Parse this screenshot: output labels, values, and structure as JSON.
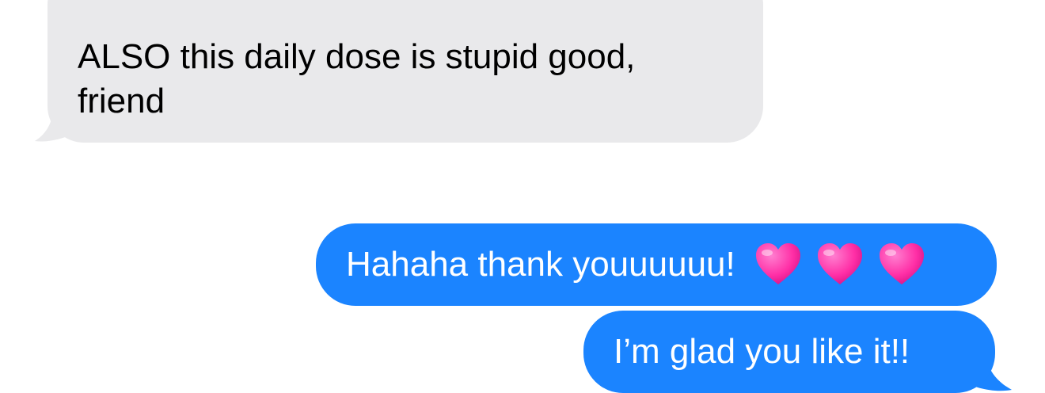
{
  "conversation": {
    "messages": [
      {
        "direction": "incoming",
        "text": "ALSO this daily dose is stupid good, friend"
      },
      {
        "direction": "outgoing",
        "text": "Hahaha thank youuuuuu!",
        "emoji": [
          "pink-heart-icon",
          "pink-heart-icon",
          "pink-heart-icon"
        ]
      },
      {
        "direction": "outgoing",
        "text": "I’m glad you like it!!"
      }
    ]
  },
  "colors": {
    "incoming_bubble": "#e9e9eb",
    "outgoing_bubble": "#1b84ff",
    "heart": "#ff2fa6"
  }
}
